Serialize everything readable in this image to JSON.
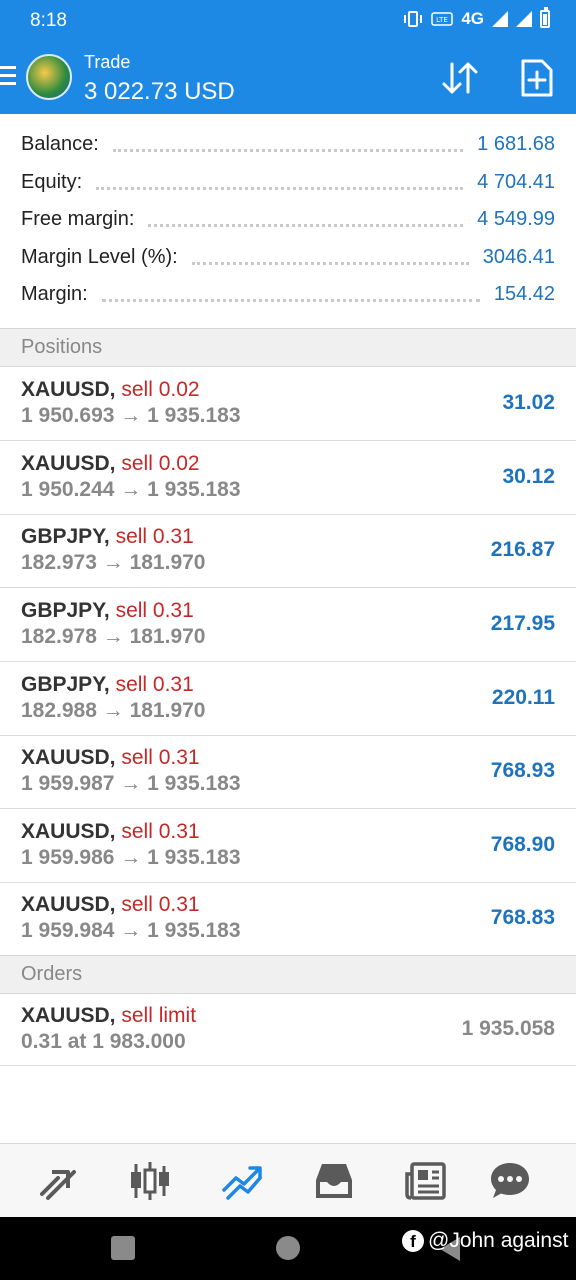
{
  "status_bar": {
    "time": "8:18",
    "network": "4G"
  },
  "header": {
    "subtitle": "Trade",
    "title": "3 022.73 USD"
  },
  "summary": [
    {
      "label": "Balance:",
      "value": "1 681.68"
    },
    {
      "label": "Equity:",
      "value": "4 704.41"
    },
    {
      "label": "Free margin:",
      "value": "4 549.99"
    },
    {
      "label": "Margin Level (%):",
      "value": "3046.41"
    },
    {
      "label": "Margin:",
      "value": "154.42"
    }
  ],
  "positions_header": "Positions",
  "positions": [
    {
      "symbol": "XAUUSD,",
      "action": "sell 0.02",
      "prices": "1 950.693 → 1 935.183",
      "profit": "31.02"
    },
    {
      "symbol": "XAUUSD,",
      "action": "sell 0.02",
      "prices": "1 950.244 → 1 935.183",
      "profit": "30.12"
    },
    {
      "symbol": "GBPJPY,",
      "action": "sell 0.31",
      "prices": "182.973 → 181.970",
      "profit": "216.87"
    },
    {
      "symbol": "GBPJPY,",
      "action": "sell 0.31",
      "prices": "182.978 → 181.970",
      "profit": "217.95"
    },
    {
      "symbol": "GBPJPY,",
      "action": "sell 0.31",
      "prices": "182.988 → 181.970",
      "profit": "220.11"
    },
    {
      "symbol": "XAUUSD,",
      "action": "sell 0.31",
      "prices": "1 959.987 → 1 935.183",
      "profit": "768.93"
    },
    {
      "symbol": "XAUUSD,",
      "action": "sell 0.31",
      "prices": "1 959.986 → 1 935.183",
      "profit": "768.90"
    },
    {
      "symbol": "XAUUSD,",
      "action": "sell 0.31",
      "prices": "1 959.984 → 1 935.183",
      "profit": "768.83"
    }
  ],
  "orders_header": "Orders",
  "orders": [
    {
      "symbol": "XAUUSD,",
      "action": "sell limit",
      "details": "0.31 at 1 983.000",
      "price": "1 935.058"
    }
  ],
  "bottom_nav": [
    {
      "icon": "quotes-icon"
    },
    {
      "icon": "chart-icon"
    },
    {
      "icon": "trade-icon",
      "active": true
    },
    {
      "icon": "history-icon"
    },
    {
      "icon": "news-icon"
    },
    {
      "icon": "chat-icon"
    }
  ],
  "watermark": {
    "text": "@John against"
  },
  "colors": {
    "accent": "#1e88e5",
    "profit": "#1e73be",
    "sell": "#c62828",
    "active_nav": "#1e88e5",
    "inactive_nav": "#5a5a5a"
  }
}
